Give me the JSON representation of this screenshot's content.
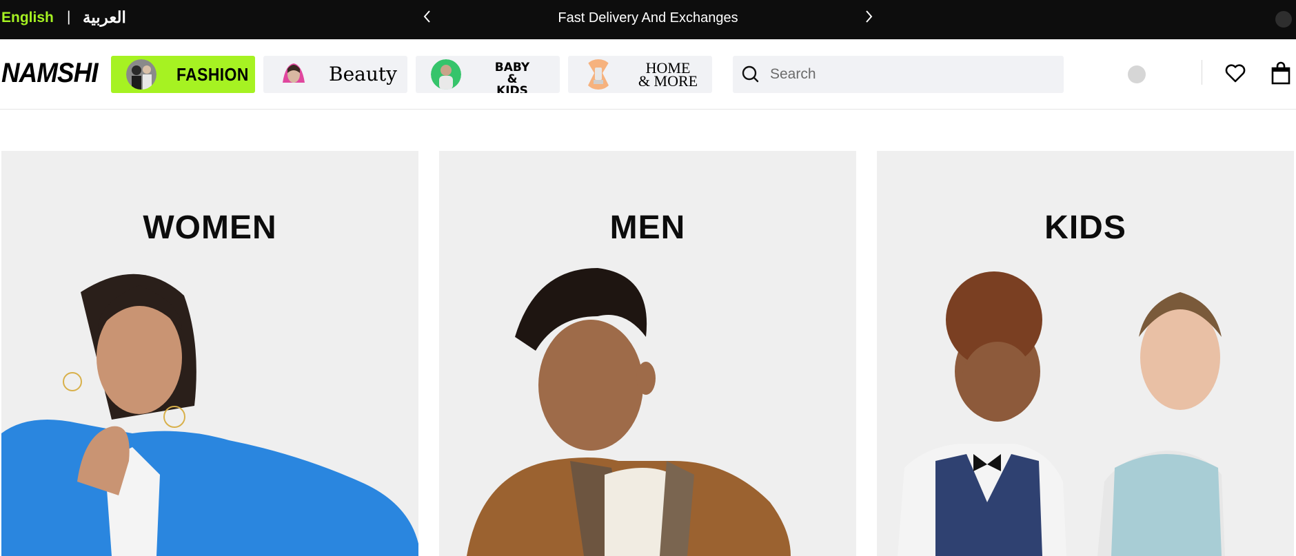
{
  "topbar": {
    "lang_english": "English",
    "lang_separator": "|",
    "lang_arabic": "العربية",
    "promo_text": "Fast Delivery And Exchanges"
  },
  "header": {
    "logo": "NAMSHI",
    "tabs": [
      {
        "label": "FASHION",
        "active": true
      },
      {
        "label": "Beauty",
        "active": false
      },
      {
        "label_line1": "BABY",
        "label_line2": "& KIDS",
        "active": false
      },
      {
        "label_line1": "HOME",
        "label_line2": "& MORE",
        "active": false
      }
    ],
    "search_placeholder": "Search"
  },
  "cards": [
    {
      "title": "WOMEN"
    },
    {
      "title": "MEN"
    },
    {
      "title": "KIDS"
    }
  ],
  "colors": {
    "accent": "#a6f222",
    "topbar_bg": "#0d0d0d",
    "card_bg": "#efefef"
  },
  "icons": [
    "chevron-left-icon",
    "chevron-right-icon",
    "search-icon",
    "heart-icon",
    "shopping-bag-icon"
  ]
}
